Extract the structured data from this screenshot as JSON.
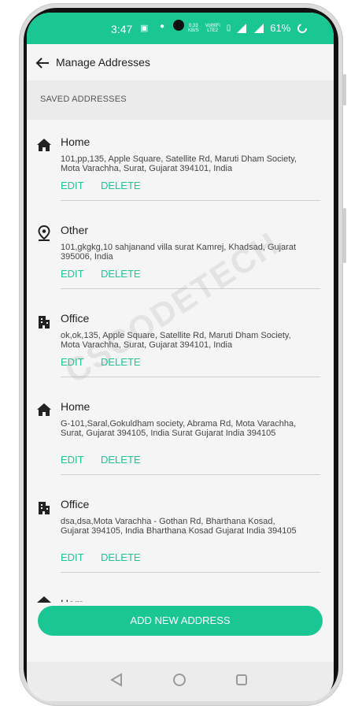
{
  "status_bar": {
    "time": "3:47",
    "net_speed_top": "0.33",
    "net_speed_bottom": "KB/S",
    "volte_top": "VoWiFi",
    "volte_bottom": "LTE2",
    "battery": "61%"
  },
  "app_bar": {
    "title": "Manage Addresses"
  },
  "section": {
    "header": "SAVED ADDRESSES"
  },
  "addresses": [
    {
      "type": "Home",
      "icon": "home-icon",
      "address": "101,pp,135, Apple Square, Satellite Rd, Maruti Dham Society, Mota Varachha, Surat, Gujarat 394101, India",
      "edit": "EDIT",
      "delete": "DELETE"
    },
    {
      "type": "Other",
      "icon": "location-pin-icon",
      "address": "101,gkgkg,10 sahjanand villa surat Kamrej, Khadsad, Gujarat 395006, India",
      "edit": "EDIT",
      "delete": "DELETE"
    },
    {
      "type": "Office",
      "icon": "office-building-icon",
      "address": "ok,ok,135, Apple Square, Satellite Rd, Maruti Dham Society, Mota Varachha, Surat, Gujarat 394101, India",
      "edit": "EDIT",
      "delete": "DELETE"
    },
    {
      "type": "Home",
      "icon": "home-icon",
      "address": "G-101,Saral,Gokuldham society, Abrama Rd, Mota Varachha, Surat, Gujarat 394105, India Surat Gujarat India 394105",
      "edit": "EDIT",
      "delete": "DELETE"
    },
    {
      "type": "Office",
      "icon": "office-building-icon",
      "address": "dsa,dsa,Mota Varachha - Gothan Rd, Bharthana Kosad, Gujarat 394105, India Bharthana Kosad Gujarat India 394105",
      "edit": "EDIT",
      "delete": "DELETE"
    }
  ],
  "partial_item_title": "Home",
  "add_button": {
    "label": "ADD NEW ADDRESS"
  },
  "watermark": "CSCODETECH",
  "colors": {
    "accent": "#1ac694",
    "background": "#f5f5f5",
    "section": "#ebebeb"
  }
}
